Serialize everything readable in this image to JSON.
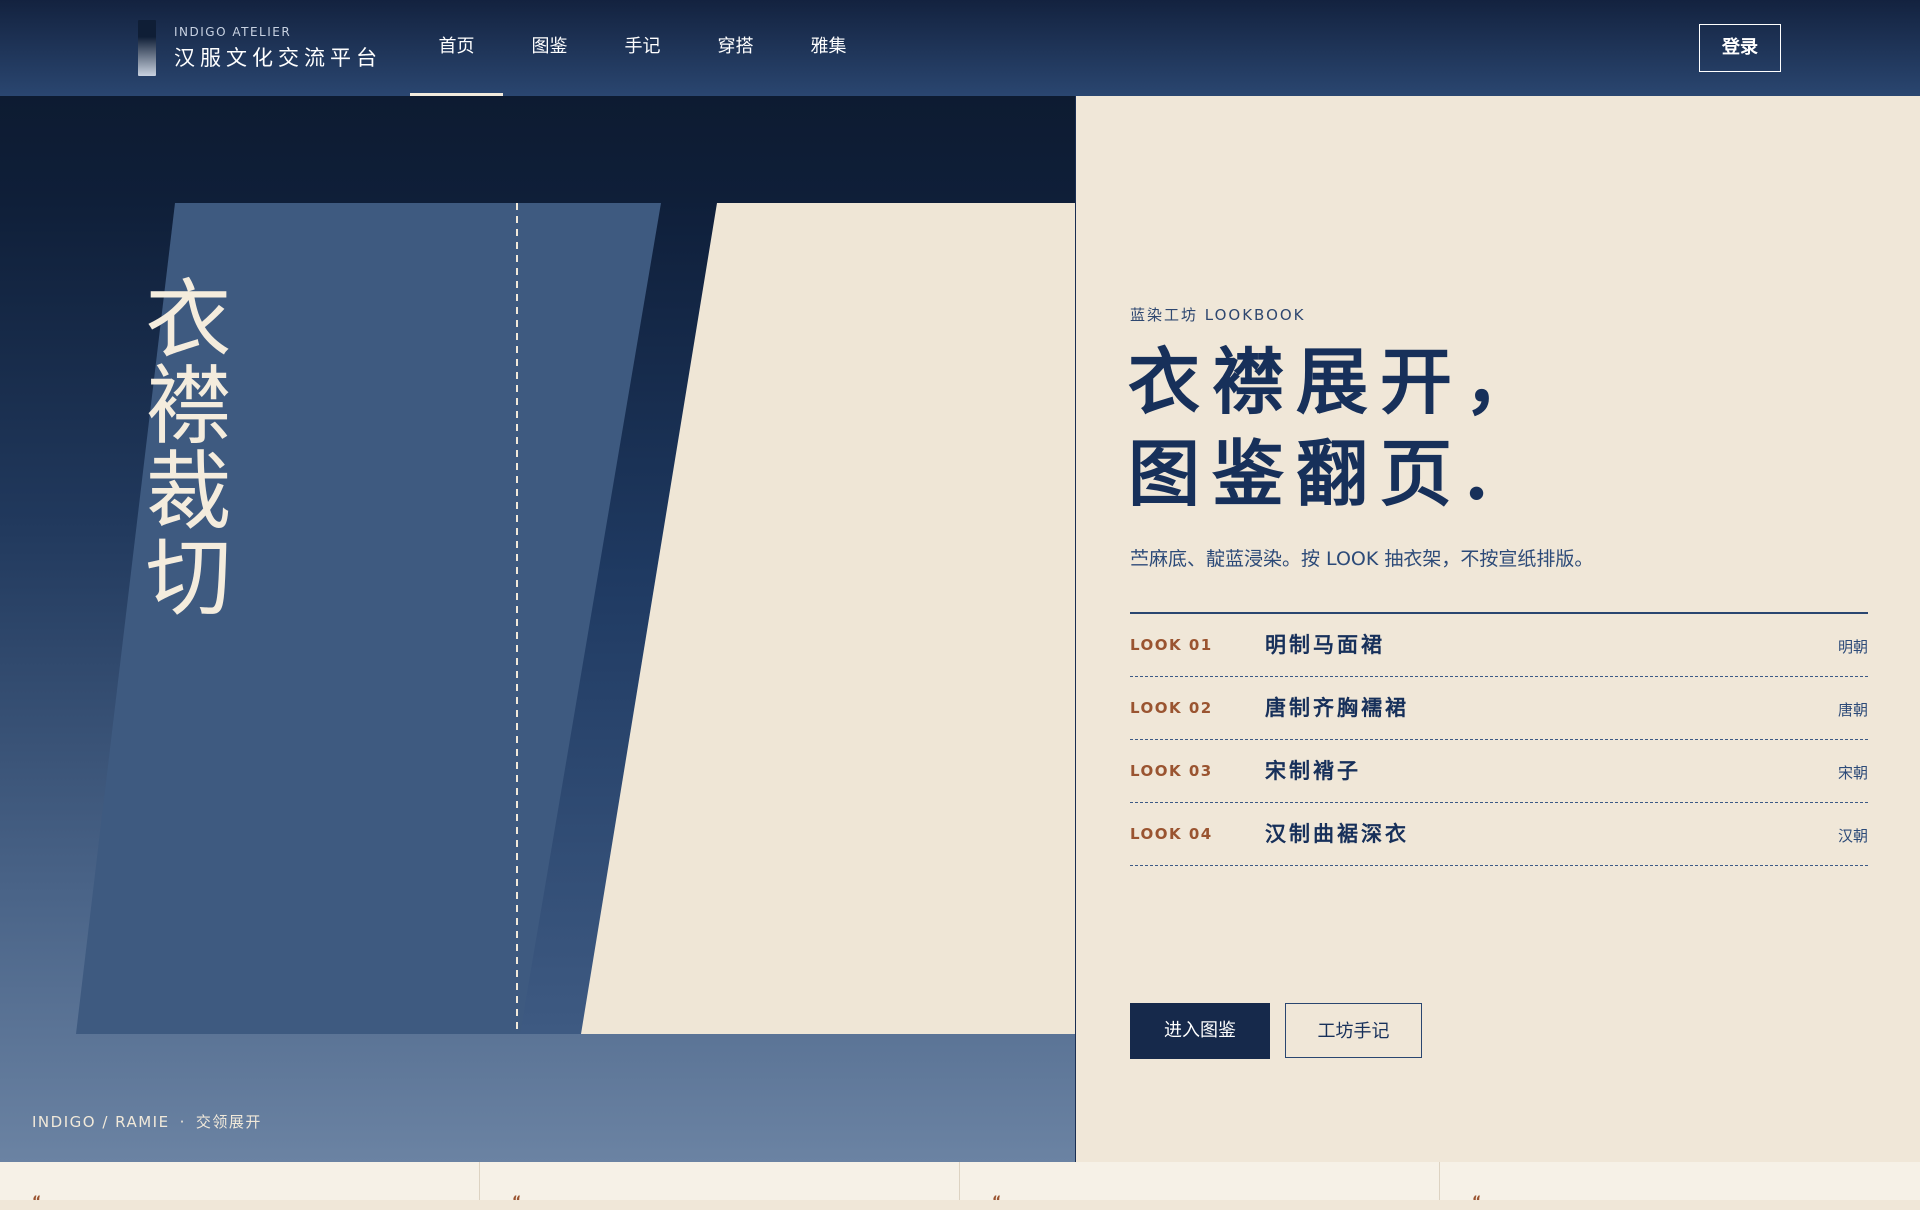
{
  "header": {
    "logo_en": "INDIGO ATELIER",
    "logo_cn": "汉服文化交流平台",
    "nav": [
      {
        "label": "首页",
        "active": true
      },
      {
        "label": "图鉴",
        "active": false
      },
      {
        "label": "手记",
        "active": false
      },
      {
        "label": "穿搭",
        "active": false
      },
      {
        "label": "雅集",
        "active": false
      }
    ],
    "login_label": "登录"
  },
  "hero": {
    "vertical_title": "衣襟裁切",
    "caption_en": "INDIGO / RAMIE",
    "caption_sep": "·",
    "caption_cn": "交领展开"
  },
  "content": {
    "eyebrow": "蓝染工坊 LOOKBOOK",
    "headline_line1": "衣襟展开，",
    "headline_line2": "图鉴翻页.",
    "lead": "苎麻底、靛蓝浸染。按 LOOK 抽衣架，不按宣纸排版。",
    "looks": [
      {
        "num": "LOOK 01",
        "name": "明制马面裙",
        "era": "明朝"
      },
      {
        "num": "LOOK 02",
        "name": "唐制齐胸襦裙",
        "era": "唐朝"
      },
      {
        "num": "LOOK 03",
        "name": "宋制褙子",
        "era": "宋朝"
      },
      {
        "num": "LOOK 04",
        "name": "汉制曲裾深衣",
        "era": "汉朝"
      }
    ],
    "primary_button": "进入图鉴",
    "secondary_button": "工坊手记"
  },
  "colors": {
    "indigo_dark": "#13223f",
    "indigo_mid": "#3e5a82",
    "paper": "#f0e7d8",
    "accent_rust": "#9a5430"
  }
}
